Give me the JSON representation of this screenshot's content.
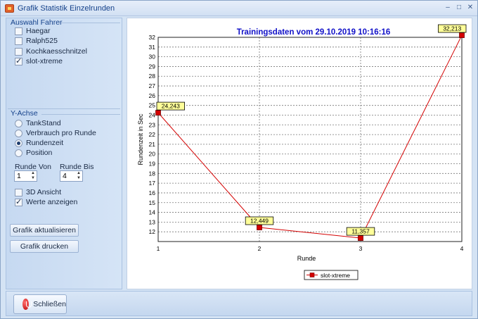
{
  "window": {
    "title": "Grafik Statistik Einzelrunden"
  },
  "fahrer": {
    "group_label": "Auswahl Fahrer",
    "items": [
      {
        "label": "Haegar",
        "checked": false
      },
      {
        "label": "Ralph525",
        "checked": false
      },
      {
        "label": "Kochkaesschnitzel",
        "checked": false
      },
      {
        "label": "slot-xtreme",
        "checked": true
      }
    ]
  },
  "yachse": {
    "group_label": "Y-Achse",
    "options": [
      {
        "label": "TankStand",
        "checked": false
      },
      {
        "label": "Verbrauch pro Runde",
        "checked": false
      },
      {
        "label": "Rundenzeit",
        "checked": true
      },
      {
        "label": "Position",
        "checked": false
      }
    ]
  },
  "runden": {
    "von_label": "Runde Von",
    "von_value": "1",
    "bis_label": "Runde Bis",
    "bis_value": "4"
  },
  "options": {
    "ansicht3d": {
      "label": "3D Ansicht",
      "checked": false
    },
    "werte": {
      "label": "Werte anzeigen",
      "checked": true
    }
  },
  "buttons": {
    "aktualisieren": "Grafik aktualisieren",
    "drucken": "Grafik drucken",
    "schliessen": "Schließen"
  },
  "colors": {
    "series": "#d40000",
    "title": "#1010c8",
    "label_bg": "#ffff99"
  },
  "chart_data": {
    "type": "line",
    "title": "Trainingsdaten vom 29.10.2019 10:16:16",
    "xlabel": "Runde",
    "ylabel": "Rundenzeit in Sec",
    "x": [
      1,
      2,
      3,
      4
    ],
    "xlim": [
      1,
      4
    ],
    "ylim": [
      11,
      32
    ],
    "yticks": [
      12,
      13,
      14,
      15,
      16,
      17,
      18,
      19,
      20,
      21,
      22,
      23,
      24,
      25,
      26,
      27,
      28,
      29,
      30,
      31,
      32
    ],
    "series": [
      {
        "name": "slot-xtreme",
        "values": [
          24.243,
          12.449,
          11.357,
          32.213
        ],
        "labels": [
          "24,243",
          "12,449",
          "11,357",
          "32,213"
        ]
      }
    ],
    "grid": true,
    "legend": "bottom-center"
  }
}
